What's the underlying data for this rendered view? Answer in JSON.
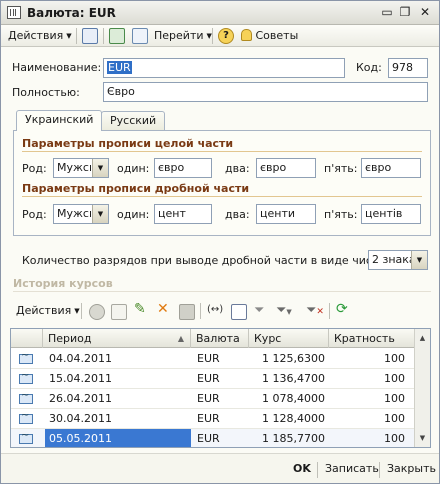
{
  "window": {
    "title": "Валюта: EUR"
  },
  "toolbar": {
    "actions_label": "Действия",
    "goto_label": "Перейти",
    "help_label": "?",
    "tips_label": "Советы"
  },
  "form": {
    "name_label": "Наименование:",
    "name_value": "EUR",
    "code_label": "Код:",
    "code_value": "978",
    "full_label": "Полностью:",
    "full_value": "Євро"
  },
  "tabs": [
    {
      "label": "Украинский",
      "active": true
    },
    {
      "label": "Русский",
      "active": false
    }
  ],
  "integer_part": {
    "title": "Параметры прописи целой части",
    "gender_label": "Род:",
    "gender_value": "Мужской",
    "one_label": "один:",
    "one_value": "євро",
    "two_label": "два:",
    "two_value": "євро",
    "five_label": "п'ять:",
    "five_value": "євро"
  },
  "fraction_part": {
    "title": "Параметры прописи дробной части",
    "gender_label": "Род:",
    "gender_value": "Мужской",
    "one_label": "один:",
    "one_value": "цент",
    "two_label": "два:",
    "two_value": "центи",
    "five_label": "п'ять:",
    "five_value": "центів"
  },
  "digits": {
    "label": "Количество разрядов при выводе дробной части в виде числа:",
    "value": "2 знака"
  },
  "history": {
    "title": "История курсов",
    "actions_label": "Действия",
    "columns": [
      "Период",
      "Валюта",
      "Курс",
      "Кратность"
    ],
    "rows": [
      {
        "period": "04.04.2011",
        "currency": "EUR",
        "rate": "1 125,6300",
        "multiplicity": "100"
      },
      {
        "period": "15.04.2011",
        "currency": "EUR",
        "rate": "1 136,4700",
        "multiplicity": "100"
      },
      {
        "period": "26.04.2011",
        "currency": "EUR",
        "rate": "1 078,4000",
        "multiplicity": "100"
      },
      {
        "period": "30.04.2011",
        "currency": "EUR",
        "rate": "1 128,4000",
        "multiplicity": "100"
      },
      {
        "period": "05.05.2011",
        "currency": "EUR",
        "rate": "1 185,7700",
        "multiplicity": "100"
      }
    ]
  },
  "footer": {
    "ok_label": "OK",
    "save_label": "Записать",
    "close_label": "Закрыть"
  }
}
